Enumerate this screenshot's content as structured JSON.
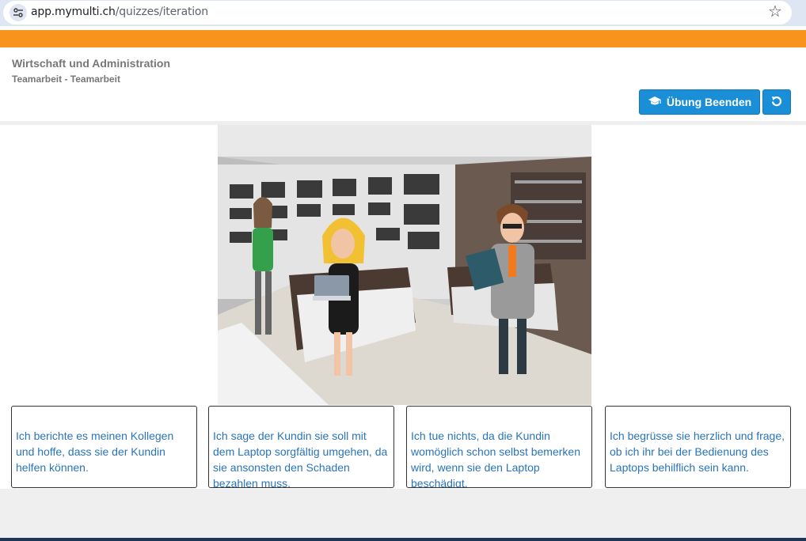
{
  "browser": {
    "url_host": "app.mymulti.ch",
    "url_path": "/quizzes/iteration"
  },
  "header": {
    "title": "Wirtschaft und Administration",
    "subtitle": "Teamarbeit - Teamarbeit",
    "end_button_label": "Übung Beenden"
  },
  "icons": {
    "site_settings": "tune-icon",
    "bookmark": "star-icon",
    "end": "graduation-cap-icon",
    "reset": "refresh-icon"
  },
  "colors": {
    "accent_orange": "#f7941d",
    "button_blue": "#1a8fd8",
    "answer_text": "#2a74b9"
  },
  "answers": [
    "Ich berichte es meinen Kollegen und hoffe, dass sie der Kundin helfen können.",
    "Ich sage der Kundin sie soll mit dem Laptop sorgfältig umgehen, da sie ansonsten den Schaden bezahlen muss.",
    "Ich tue nichts, da die Kundin womöglich schon selbst bemerken wird, wenn sie den Laptop beschädigt.",
    "Ich begrüsse sie herzlich und frage, ob ich ihr bei der Bedienung des Laptops behilflich sein kann."
  ]
}
